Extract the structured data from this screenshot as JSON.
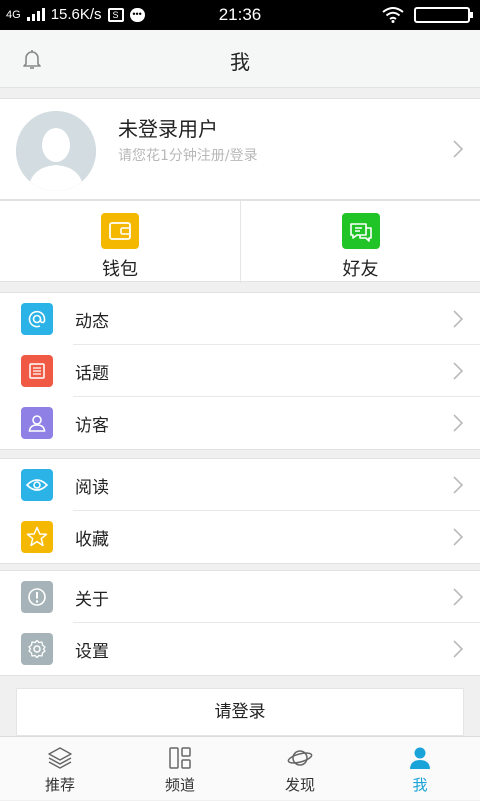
{
  "status_bar": {
    "network": "4G",
    "speed": "15.6K/s",
    "s_icon": "S",
    "chat_icon": "•••",
    "time": "21:36"
  },
  "header": {
    "title": "我"
  },
  "profile": {
    "name": "未登录用户",
    "hint": "请您花1分钟注册/登录"
  },
  "quick": [
    {
      "label": "钱包",
      "icon": "wallet-icon",
      "color": "#f5b800"
    },
    {
      "label": "好友",
      "icon": "friends-chat-icon",
      "color": "#21c427"
    }
  ],
  "menu_group_1": [
    {
      "label": "动态",
      "icon": "at-icon",
      "color": "#2bb3e8"
    },
    {
      "label": "话题",
      "icon": "topic-list-icon",
      "color": "#f05a44"
    },
    {
      "label": "访客",
      "icon": "visitor-icon",
      "color": "#8f80e6"
    }
  ],
  "menu_group_2": [
    {
      "label": "阅读",
      "icon": "eye-icon",
      "color": "#2bb3e8"
    },
    {
      "label": "收藏",
      "icon": "star-icon",
      "color": "#f5b800"
    }
  ],
  "menu_group_3": [
    {
      "label": "关于",
      "icon": "info-icon",
      "color": "#a6b3b8"
    },
    {
      "label": "设置",
      "icon": "gear-icon",
      "color": "#a6b3b8"
    }
  ],
  "login_button": "请登录",
  "bottom_nav": [
    {
      "label": "推荐",
      "icon": "layers-icon",
      "active": false
    },
    {
      "label": "频道",
      "icon": "channel-grid-icon",
      "active": false
    },
    {
      "label": "发现",
      "icon": "planet-icon",
      "active": false
    },
    {
      "label": "我",
      "icon": "person-icon",
      "active": true
    }
  ],
  "colors": {
    "accent": "#1aa3d9",
    "hint": "#b8b8b8",
    "background": "#f0f0f0"
  }
}
